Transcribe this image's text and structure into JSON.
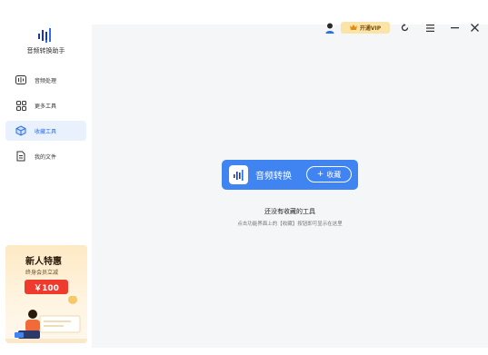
{
  "app": {
    "name": "音频转换助手"
  },
  "sidebar": {
    "items": [
      {
        "label": "音频处理",
        "icon": "audio-wave-icon",
        "active": false
      },
      {
        "label": "更多工具",
        "icon": "grid-icon",
        "active": false
      },
      {
        "label": "收藏工具",
        "icon": "cube-icon",
        "active": true
      },
      {
        "label": "我的文件",
        "icon": "file-icon",
        "active": false
      }
    ]
  },
  "promo": {
    "title": "新人特惠",
    "subtitle": "终身会员立减",
    "price": "￥100"
  },
  "titlebar": {
    "vip_label": "开通VIP",
    "icons": [
      "user-icon",
      "crown-icon",
      "refresh-icon",
      "menu-icon",
      "minimize-icon",
      "close-icon"
    ]
  },
  "favorites": {
    "tool_name": "音频转换",
    "collect_label": "收藏",
    "empty_title": "还没有收藏的工具",
    "empty_hint": "点击功能界面上的【收藏】按钮即可显示在这里"
  },
  "colors": {
    "accent": "#3f84f1",
    "active_bg": "#e9f1fd",
    "vip_bg": "#fbe4a8",
    "promo_price": "#ef3b2e"
  }
}
